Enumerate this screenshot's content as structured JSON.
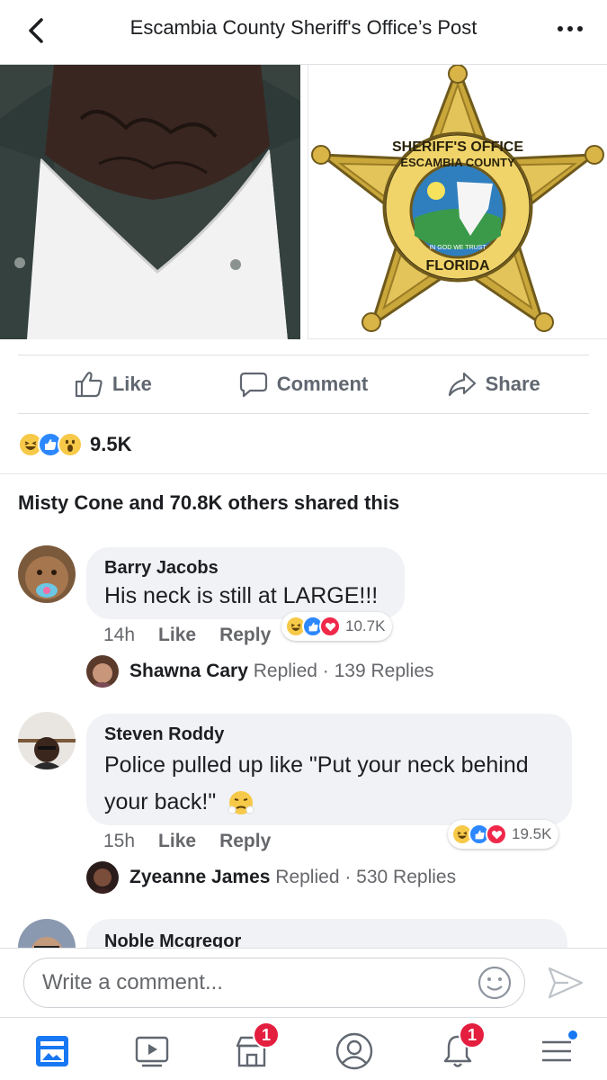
{
  "header": {
    "title": "Escambia County Sheriff's Office’s Post"
  },
  "badge_image": {
    "top_text": "SHERIFF'S OFFICE",
    "county_text": "ESCAMBIA COUNTY",
    "bottom_text": "FLORIDA",
    "motto": "IN GOD WE TRUST"
  },
  "actions": {
    "like": "Like",
    "comment": "Comment",
    "share": "Share"
  },
  "post_reactions": {
    "count": "9.5K",
    "types": [
      "haha",
      "like",
      "wow"
    ]
  },
  "shared_text": "Misty Cone and 70.8K others shared this",
  "comments": [
    {
      "name": "Barry Jacobs",
      "text": "His neck is still at LARGE!!!",
      "time": "14h",
      "like": "Like",
      "reply": "Reply",
      "reaction_count": "10.7K",
      "reactions": [
        "haha",
        "like",
        "love"
      ],
      "replied_by": "Shawna Cary",
      "replied_word": "Replied",
      "replies": "· 139 Replies"
    },
    {
      "name": "Steven Roddy",
      "text_line1": "Police pulled up like \"Put your neck behind",
      "text_line2": "your back!\"",
      "time": "15h",
      "like": "Like",
      "reply": "Reply",
      "reaction_count": "19.5K",
      "reactions": [
        "haha",
        "like",
        "love"
      ],
      "replied_by": "Zyeanne James",
      "replied_word": "Replied",
      "replies": "· 530 Replies"
    },
    {
      "name": "Noble Mcgregor"
    }
  ],
  "compose": {
    "placeholder": "Write a comment..."
  },
  "tabbar": {
    "marketplace_badge": "1",
    "notifications_badge": "1"
  },
  "colors": {
    "brand_blue": "#1877f2",
    "like_blue": "#2d88ff",
    "love_red": "#f0284a",
    "haha_yellow": "#f7c949",
    "badge_red": "#e41e3f"
  }
}
